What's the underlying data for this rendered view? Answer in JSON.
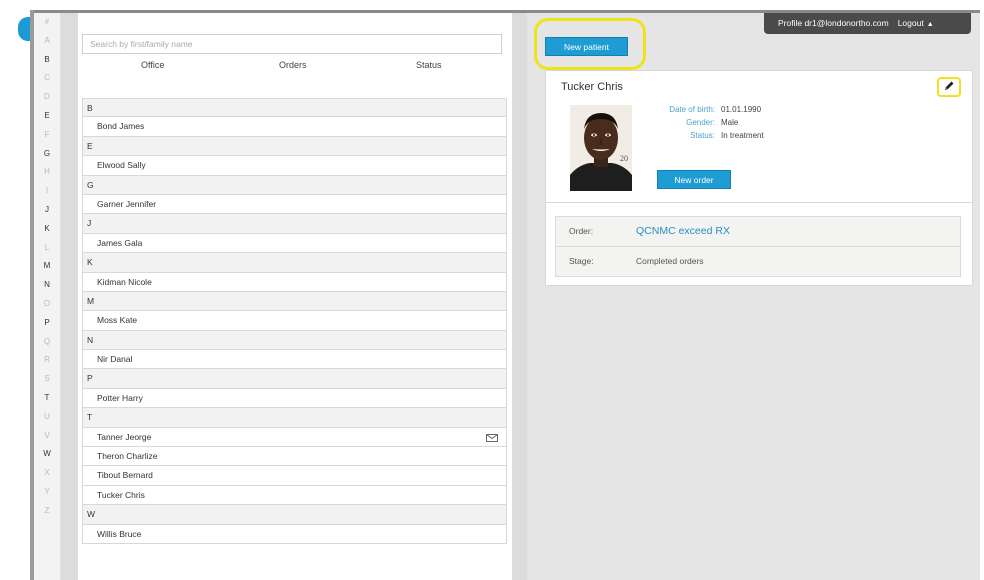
{
  "alphabet": [
    {
      "letter": "#",
      "active": false
    },
    {
      "letter": "A",
      "active": false
    },
    {
      "letter": "B",
      "active": true
    },
    {
      "letter": "C",
      "active": false
    },
    {
      "letter": "D",
      "active": false
    },
    {
      "letter": "E",
      "active": true
    },
    {
      "letter": "F",
      "active": false
    },
    {
      "letter": "G",
      "active": true
    },
    {
      "letter": "H",
      "active": false
    },
    {
      "letter": "I",
      "active": false
    },
    {
      "letter": "J",
      "active": true
    },
    {
      "letter": "K",
      "active": true
    },
    {
      "letter": "L",
      "active": false
    },
    {
      "letter": "M",
      "active": true
    },
    {
      "letter": "N",
      "active": true
    },
    {
      "letter": "O",
      "active": false
    },
    {
      "letter": "P",
      "active": true
    },
    {
      "letter": "Q",
      "active": false
    },
    {
      "letter": "R",
      "active": false
    },
    {
      "letter": "S",
      "active": false
    },
    {
      "letter": "T",
      "active": true
    },
    {
      "letter": "U",
      "active": false
    },
    {
      "letter": "V",
      "active": false
    },
    {
      "letter": "W",
      "active": true
    },
    {
      "letter": "X",
      "active": false
    },
    {
      "letter": "Y",
      "active": false
    },
    {
      "letter": "Z",
      "active": false
    }
  ],
  "search": {
    "placeholder": "Search by first/family name"
  },
  "columns": {
    "office": "Office",
    "orders": "Orders",
    "status": "Status"
  },
  "patient_list": [
    {
      "type": "letter",
      "text": "B"
    },
    {
      "type": "name",
      "text": "Bond James"
    },
    {
      "type": "letter",
      "text": "E"
    },
    {
      "type": "name",
      "text": "Elwood Sally"
    },
    {
      "type": "letter",
      "text": "G"
    },
    {
      "type": "name",
      "text": "Garner Jennifer"
    },
    {
      "type": "letter",
      "text": "J"
    },
    {
      "type": "name",
      "text": "James Gala"
    },
    {
      "type": "letter",
      "text": "K"
    },
    {
      "type": "name",
      "text": "Kidman Nicole"
    },
    {
      "type": "letter",
      "text": "M"
    },
    {
      "type": "name",
      "text": "Moss Kate"
    },
    {
      "type": "letter",
      "text": "N"
    },
    {
      "type": "name",
      "text": "Nir Danal"
    },
    {
      "type": "letter",
      "text": "P"
    },
    {
      "type": "name",
      "text": "Potter Harry"
    },
    {
      "type": "letter",
      "text": "T"
    },
    {
      "type": "name",
      "text": "Tanner Jeorge",
      "message_icon": "mail-icon"
    },
    {
      "type": "name",
      "text": "Theron Charlize"
    },
    {
      "type": "name",
      "text": "Tibout Bernard"
    },
    {
      "type": "name",
      "text": "Tucker Chris"
    },
    {
      "type": "letter",
      "text": "W"
    },
    {
      "type": "name",
      "text": "Willis Bruce"
    }
  ],
  "topbar": {
    "profile": "Profile dr1@londonortho.com",
    "logout": "Logout",
    "logout_icon": "chevron-up-icon"
  },
  "new_patient_label": "New patient",
  "patient": {
    "name": "Tucker Chris",
    "edit_icon": "pencil-icon",
    "fields": [
      {
        "label": "Date of birth:",
        "value": "01.01.1990"
      },
      {
        "label": "Gender:",
        "value": "Male"
      },
      {
        "label": "Status:",
        "value": "In treatment"
      }
    ],
    "new_order_label": "New order",
    "order": {
      "label": "Order:",
      "value": "QCNMC exceed RX"
    },
    "stage": {
      "label": "Stage:",
      "value": "Completed orders"
    }
  },
  "colors": {
    "accent": "#1f9cd4",
    "highlight": "#f0e21a",
    "topbar": "#4a4a4a"
  }
}
